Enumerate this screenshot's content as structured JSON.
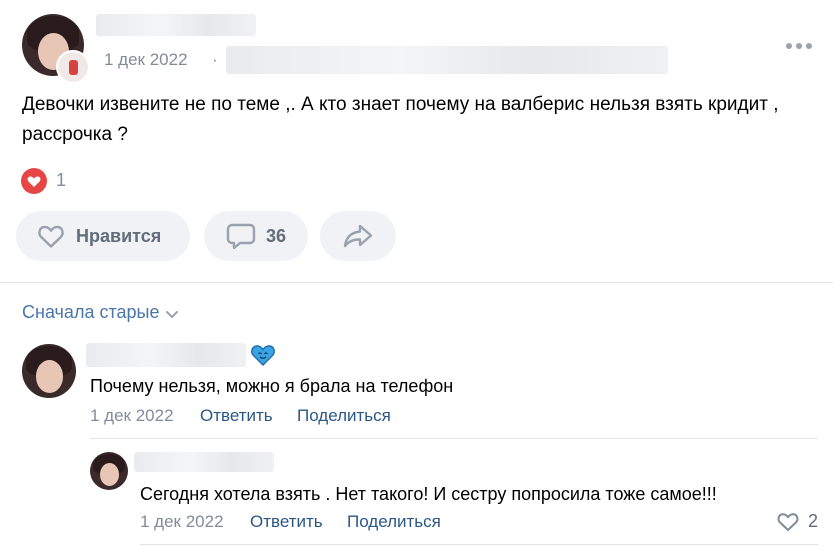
{
  "post": {
    "date": "1 дек 2022",
    "separator": "·",
    "text": "Девочки извените не по теме ,. А кто знает почему на валберис нельзя взять кридит , рассрочка ?",
    "reactions_count": "1",
    "like_label": "Нравится",
    "comments_count": "36"
  },
  "comments": {
    "sort_label": "Сначала старые",
    "items": [
      {
        "text": "Почему нельзя, можно я брала на телефон",
        "date": "1 дек 2022",
        "reply_label": "Ответить",
        "share_label": "Поделиться"
      }
    ],
    "replies": [
      {
        "text": "Сегодня хотела взять . Нет такого! И сестру попросила тоже самое!!!",
        "date": "1 дек 2022",
        "reply_label": "Ответить",
        "share_label": "Поделиться",
        "likes": "2"
      }
    ]
  },
  "colors": {
    "accent": "#2a5885",
    "muted": "#818c99",
    "heart": "#e64646",
    "pill_bg": "#f0f2f5"
  }
}
